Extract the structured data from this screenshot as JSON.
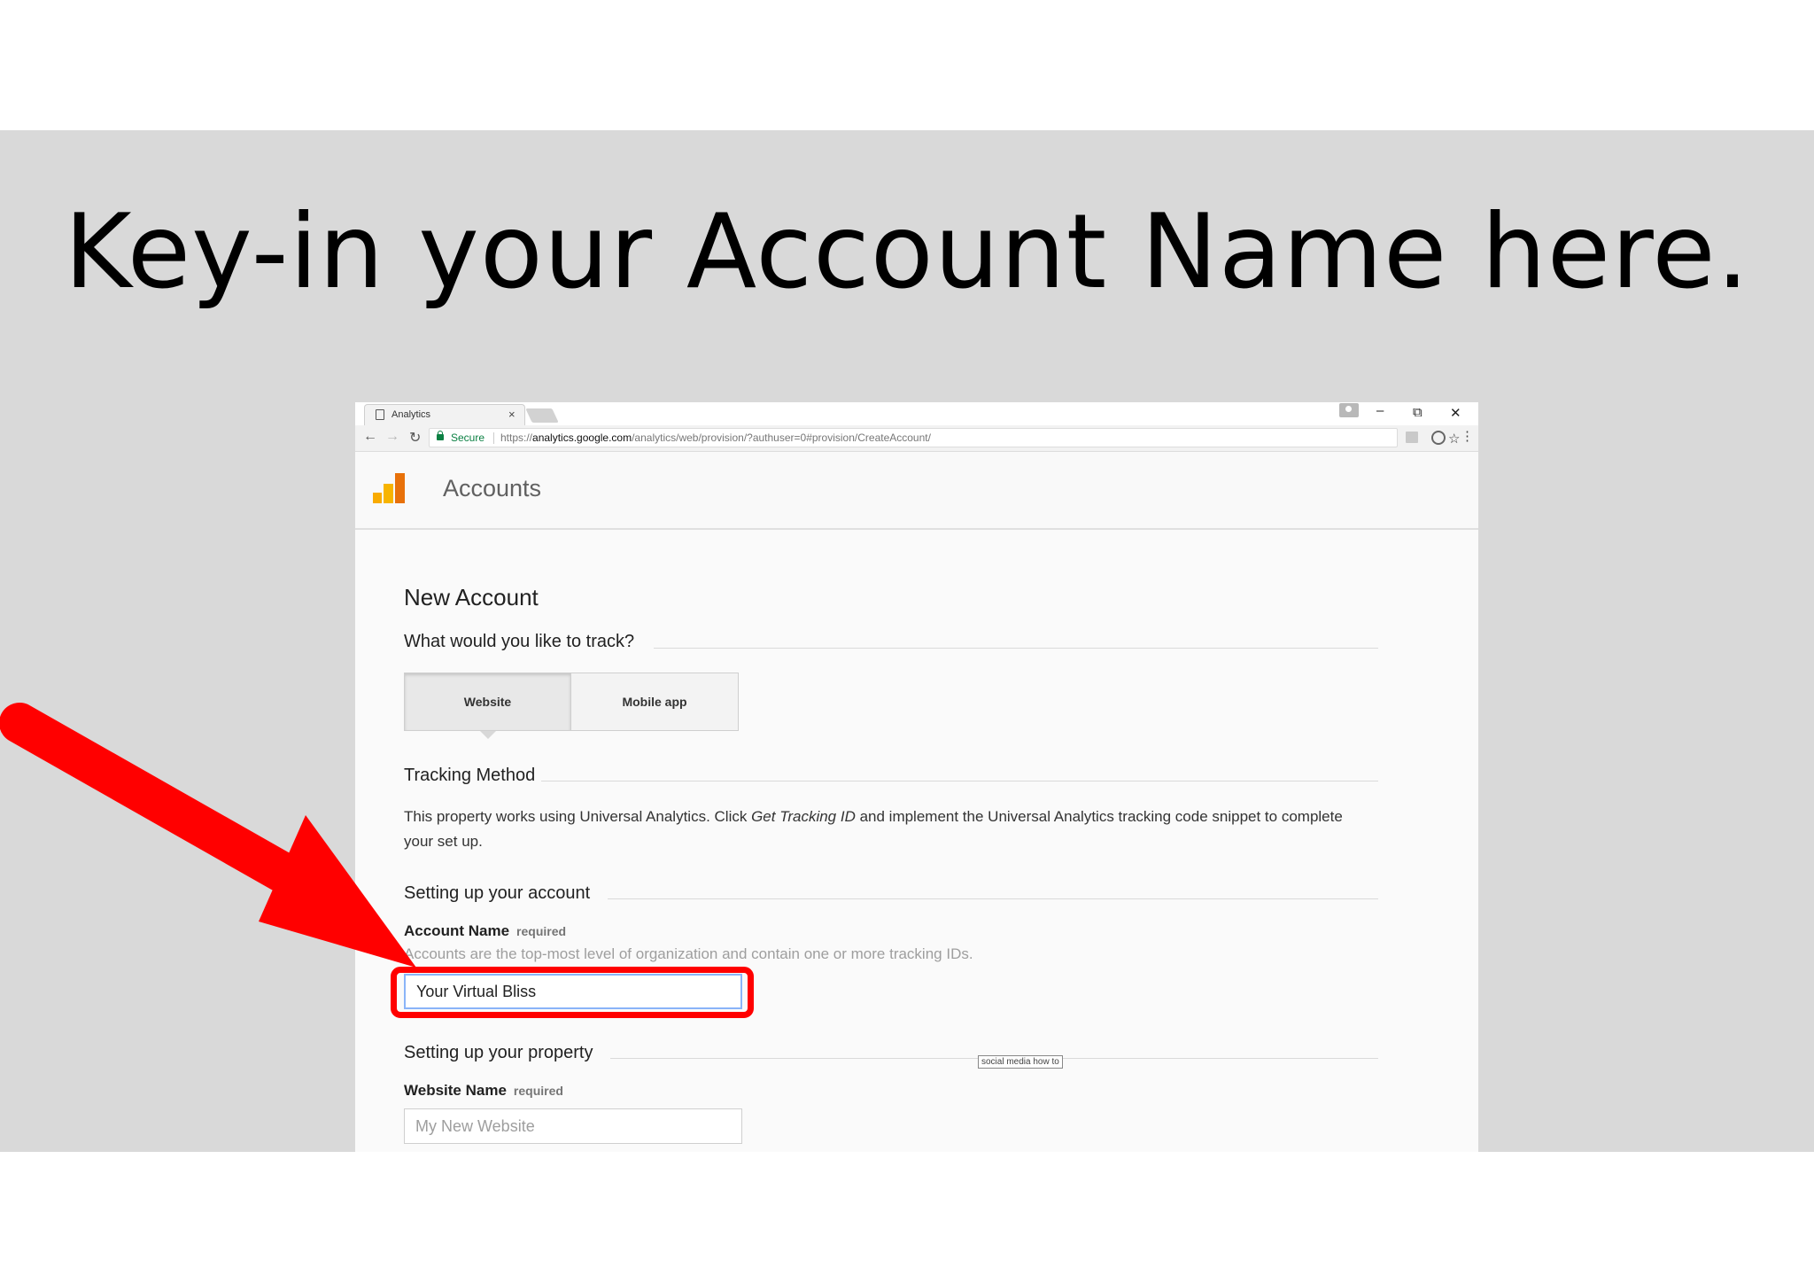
{
  "slide": {
    "title": "Key-in your Account Name here."
  },
  "browser": {
    "tab_title": "Analytics",
    "tab_close": "×",
    "window_controls": {
      "minimize": "–",
      "restore": "⧉",
      "close": "✕"
    },
    "nav": {
      "back": "←",
      "forward": "→",
      "reload": "↻"
    },
    "secure_label": "Secure",
    "url_scheme": "https://",
    "url_host": "analytics.google.com",
    "url_path": "/analytics/web/provision/?authuser=0#provision/CreateAccount/",
    "star": "☆",
    "menu": "⋮"
  },
  "app": {
    "header_title": "Accounts",
    "logo_colors": [
      "#f9ab00",
      "#f7b400",
      "#e8710a"
    ]
  },
  "form": {
    "page_title": "New Account",
    "track_question": "What would you like to track?",
    "track_options": {
      "website": "Website",
      "mobile": "Mobile app"
    },
    "selected_option": "Website",
    "tracking_method_heading": "Tracking Method",
    "tracking_desc_part1": "This property works using Universal Analytics. Click ",
    "tracking_desc_em": "Get Tracking ID",
    "tracking_desc_part2": " and implement the Universal Analytics tracking code snippet to complete your set up.",
    "account_section_heading": "Setting up your account",
    "account_name_label": "Account Name",
    "required_label": "required",
    "account_name_help": "Accounts are the top-most level of organization and contain one or more tracking IDs.",
    "account_name_value": "Your Virtual Bliss",
    "property_section_heading": "Setting up your property",
    "website_name_label": "Website Name",
    "website_name_placeholder": "My New Website"
  },
  "watermark_tag": "social media how to",
  "annotation": {
    "color": "#ff0000"
  }
}
